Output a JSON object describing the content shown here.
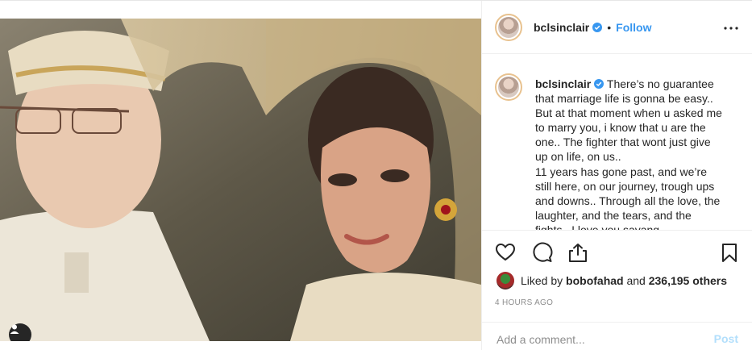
{
  "post": {
    "user": {
      "username": "bclsinclair",
      "separator": "•",
      "follow_label": "Follow",
      "verified": true
    },
    "more_icon": "more-horizontal-icon",
    "caption_lines": [
      "There’s no guarantee",
      "that marriage life is gonna be easy..",
      "But at that moment when u asked me",
      "to marry you, i know that u are the",
      "one.. The fighter that wont just give",
      "up on life, on us..",
      "11 years has gone past, and we’re",
      "still here, on our journey, trough ups",
      "and downs.. Through all the love, the",
      "laughter, and the tears, and the",
      "fights.. I love you sayang"
    ],
    "likes": {
      "prefix": "Liked by",
      "user": "bobofahad",
      "conj": "and",
      "others": "236,195 others"
    },
    "timestamp": "4 HOURS AGO",
    "comment": {
      "placeholder": "Add a comment...",
      "value": "",
      "post_label": "Post"
    },
    "icons": [
      "heart-icon",
      "comment-icon",
      "share-icon",
      "bookmark-icon",
      "user-tag-icon"
    ],
    "colors": {
      "follow": "#3897f0",
      "post_disabled": "#b2dffc",
      "secondary_text": "#8e8e8e",
      "border": "#efefef"
    }
  }
}
